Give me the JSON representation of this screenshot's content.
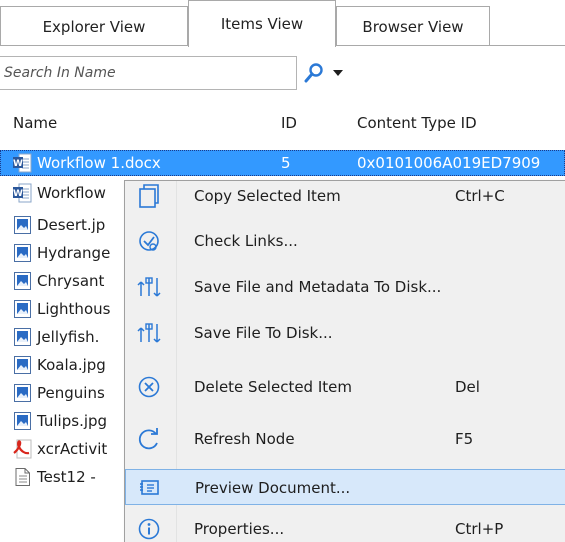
{
  "tabs": [
    "Explorer View",
    "Items View",
    "Browser View"
  ],
  "active_tab": "Items View",
  "search": {
    "placeholder": "Search In Name"
  },
  "columns": {
    "name": "Name",
    "id": "ID",
    "content_type": "Content Type ID"
  },
  "items": [
    {
      "name": "Workflow 1.docx",
      "id": "5",
      "content_type": "0x0101006A019ED7909",
      "icon": "word-doc-icon"
    },
    {
      "name": "Workflow",
      "icon": "word-doc-icon"
    },
    {
      "name": "Desert.jp",
      "icon": "image-file-icon"
    },
    {
      "name": "Hydrange",
      "icon": "image-file-icon"
    },
    {
      "name": "Chrysant",
      "icon": "image-file-icon"
    },
    {
      "name": "Lighthous",
      "icon": "image-file-icon"
    },
    {
      "name": "Jellyfish.",
      "icon": "image-file-icon"
    },
    {
      "name": "Koala.jpg",
      "icon": "image-file-icon"
    },
    {
      "name": "Penguins",
      "icon": "image-file-icon"
    },
    {
      "name": "Tulips.jpg",
      "icon": "image-file-icon"
    },
    {
      "name": "xcrActivit",
      "icon": "pdf-file-icon"
    },
    {
      "name": "Test12 -",
      "icon": "text-file-icon"
    }
  ],
  "context_menu": [
    {
      "label": "Copy Selected Item",
      "shortcut": "Ctrl+C",
      "icon": "copy-icon"
    },
    {
      "label": "Check Links...",
      "shortcut": "",
      "icon": "check-links-icon"
    },
    {
      "label": "Save File and Metadata To Disk...",
      "shortcut": "",
      "icon": "save-to-disk-icon"
    },
    {
      "label": "Save File To Disk...",
      "shortcut": "",
      "icon": "save-to-disk-icon"
    },
    {
      "label": "Delete Selected Item",
      "shortcut": "Del",
      "icon": "delete-icon"
    },
    {
      "label": "Refresh Node",
      "shortcut": "F5",
      "icon": "refresh-icon"
    },
    {
      "label": "Preview Document...",
      "shortcut": "",
      "icon": "preview-icon",
      "highlighted": true
    },
    {
      "label": "Properties...",
      "shortcut": "Ctrl+P",
      "icon": "properties-icon"
    }
  ],
  "colors": {
    "selection": "#3399ff",
    "menu_highlight": "#d7e8fa",
    "icon_blue": "#2b79d6"
  }
}
